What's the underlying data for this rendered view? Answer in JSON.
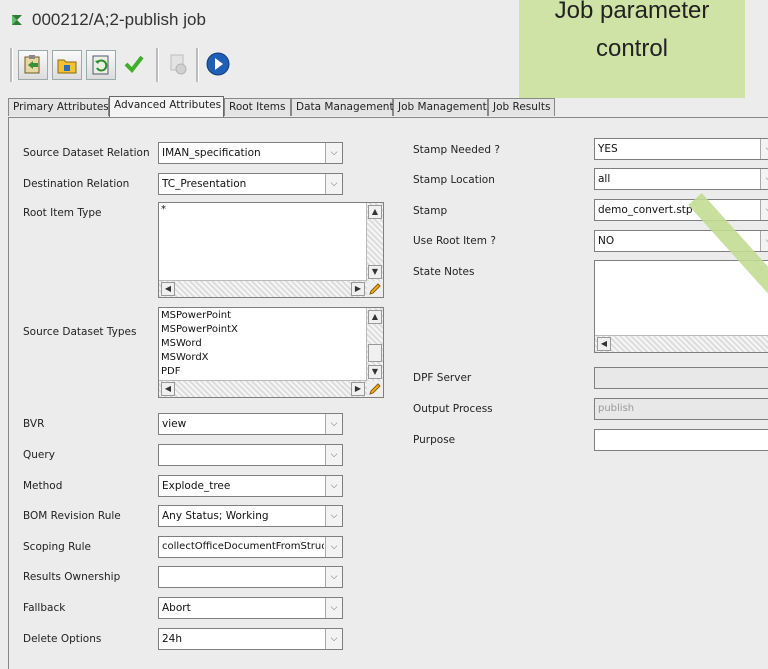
{
  "window": {
    "title": "000212/A;2-publish job"
  },
  "callout": {
    "text": "Job parameter\ncontrol"
  },
  "toolbar": {
    "icons": [
      "paste-icon",
      "folder-icon",
      "refresh-icon",
      "checkmark-icon",
      "settings-icon",
      "play-icon"
    ]
  },
  "tabs": [
    "Primary Attributes",
    "Advanced Attributes",
    "Root Items",
    "Data Management",
    "Job Management",
    "Job Results"
  ],
  "active_tab": "Advanced Attributes",
  "left": {
    "source_dataset_relation": {
      "label": "Source Dataset Relation",
      "value": "IMAN_specification"
    },
    "destination_relation": {
      "label": "Destination Relation",
      "value": "TC_Presentation"
    },
    "root_item_type": {
      "label": "Root Item Type",
      "items": [
        "*"
      ]
    },
    "source_dataset_types": {
      "label": "Source Dataset Types",
      "items": [
        "MSPowerPoint",
        "MSPowerPointX",
        "MSWord",
        "MSWordX",
        "PDF"
      ]
    },
    "bvr": {
      "label": "BVR",
      "value": "view"
    },
    "query": {
      "label": "Query",
      "value": ""
    },
    "method": {
      "label": "Method",
      "value": "Explode_tree"
    },
    "bom_revision_rule": {
      "label": "BOM Revision Rule",
      "value": "Any Status; Working"
    },
    "scoping_rule": {
      "label": "Scoping Rule",
      "value": "collectOfficeDocumentFromStruc"
    },
    "results_ownership": {
      "label": "Results Ownership",
      "value": ""
    },
    "fallback": {
      "label": "Fallback",
      "value": "Abort"
    },
    "delete_options": {
      "label": "Delete Options",
      "value": "24h"
    }
  },
  "right": {
    "stamp_needed": {
      "label": "Stamp Needed ?",
      "value": "YES"
    },
    "stamp_location": {
      "label": "Stamp Location",
      "value": "all"
    },
    "stamp": {
      "label": "Stamp",
      "value": "demo_convert.stp"
    },
    "use_root_item": {
      "label": "Use Root Item ?",
      "value": "NO"
    },
    "state_notes": {
      "label": "State Notes",
      "value": ""
    },
    "dpf_server": {
      "label": "DPF Server",
      "value": ""
    },
    "output_process": {
      "label": "Output Process",
      "value": "publish"
    },
    "purpose": {
      "label": "Purpose",
      "value": ""
    }
  },
  "colors": {
    "callout": "#cfe3a6",
    "background": "#ececec"
  }
}
